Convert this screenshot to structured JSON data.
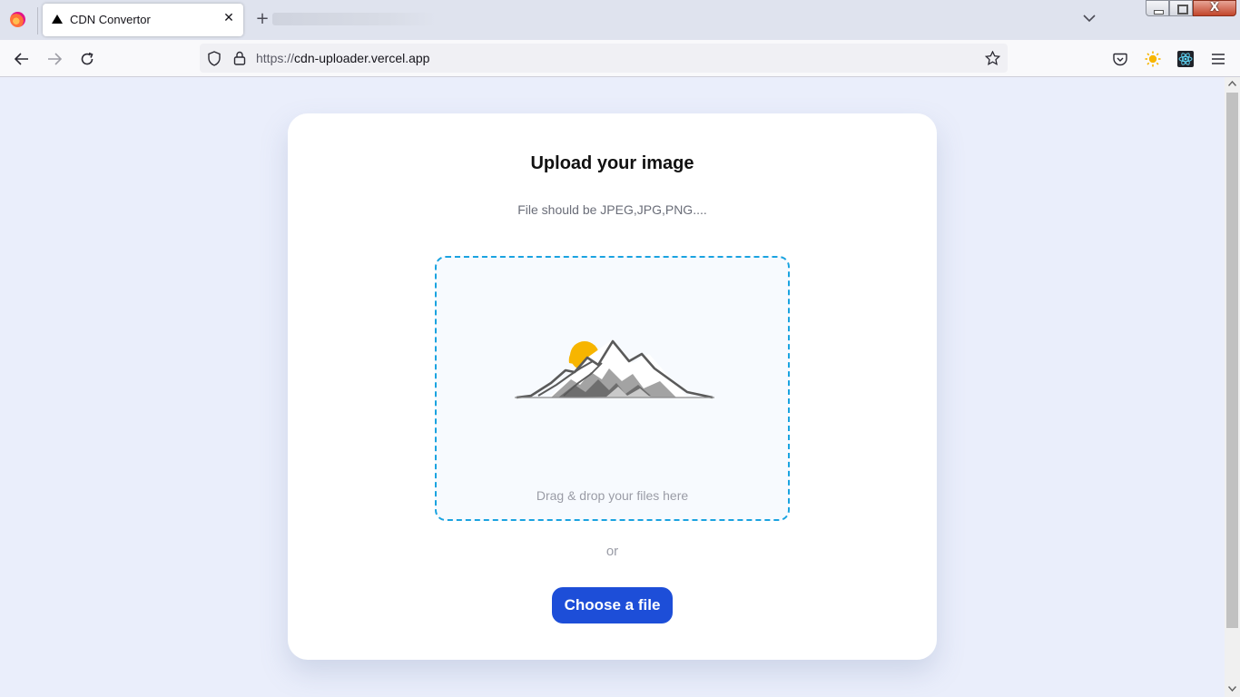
{
  "browser": {
    "active_tab": {
      "title": "CDN Convertor",
      "favicon": "triangle-icon",
      "close_glyph": "✕"
    },
    "newtab_glyph": "+",
    "list_tabs_glyph": "⌄",
    "window_close_glyph": "X",
    "url": {
      "scheme": "https://",
      "host": "cdn-uploader.vercel.app"
    },
    "toolbar_icons": [
      "back-icon",
      "forward-icon",
      "reload-icon",
      "shield-icon",
      "lock-icon",
      "star-icon",
      "pocket-icon",
      "sun-extension-icon",
      "react-devtools-icon",
      "menu-icon"
    ]
  },
  "page": {
    "title": "Upload your image",
    "subtitle": "File should be JPEG,JPG,PNG....",
    "dropzone": {
      "text": "Drag & drop your files here",
      "illustration": "mountain-sun-icon"
    },
    "separator": "or",
    "button_label": "Choose a file"
  },
  "colors": {
    "accent": "#1d4ed8",
    "dropzone_border": "#1aa3e0",
    "background": "#eaeefb",
    "sun": "#f7b500"
  }
}
